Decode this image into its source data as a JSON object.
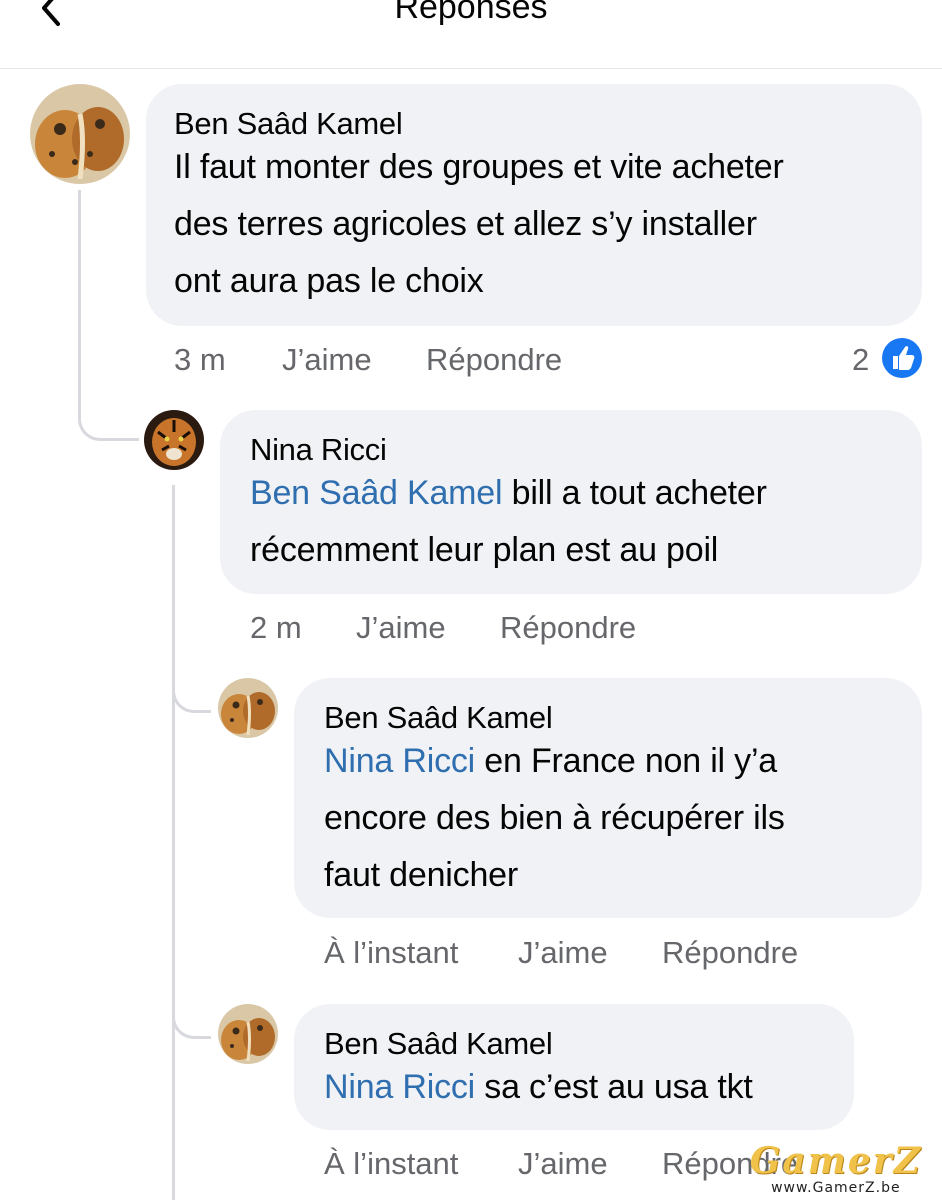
{
  "header": {
    "title": "Réponses",
    "back_icon": "chevron-left-icon"
  },
  "comments": [
    {
      "author": "Ben Saâd Kamel",
      "mention": "",
      "lines": [
        "Il faut monter des groupes et vite acheter",
        "des terres agricoles et allez s’y installer",
        "ont aura pas le choix"
      ],
      "time": "3 m",
      "like": "J’aime",
      "reply": "Répondre",
      "reaction_count": "2"
    },
    {
      "author": "Nina Ricci",
      "mention": "Ben Saâd Kamel",
      "lines": [
        " bill a tout acheter",
        "récemment leur plan est au poil"
      ],
      "time": "2 m",
      "like": "J’aime",
      "reply": "Répondre"
    },
    {
      "author": "Ben Saâd Kamel",
      "mention": "Nina Ricci",
      "lines": [
        " en France non il y’a",
        "encore des bien à récupérer ils",
        "faut denicher"
      ],
      "time": "À l’instant",
      "like": "J’aime",
      "reply": "Répondre"
    },
    {
      "author": "Ben Saâd Kamel",
      "mention": "Nina Ricci",
      "lines": [
        " sa c’est au usa tkt"
      ],
      "time": "À l’instant",
      "like": "J’aime",
      "reply": "Répondre"
    }
  ],
  "watermark": {
    "logo": "GamerZ",
    "url": "www.GamerZ.be"
  },
  "colors": {
    "bubble": "#f0f2f5",
    "mention": "#2f6fb0",
    "like_badge": "#1877f2",
    "muted": "#65676b"
  }
}
